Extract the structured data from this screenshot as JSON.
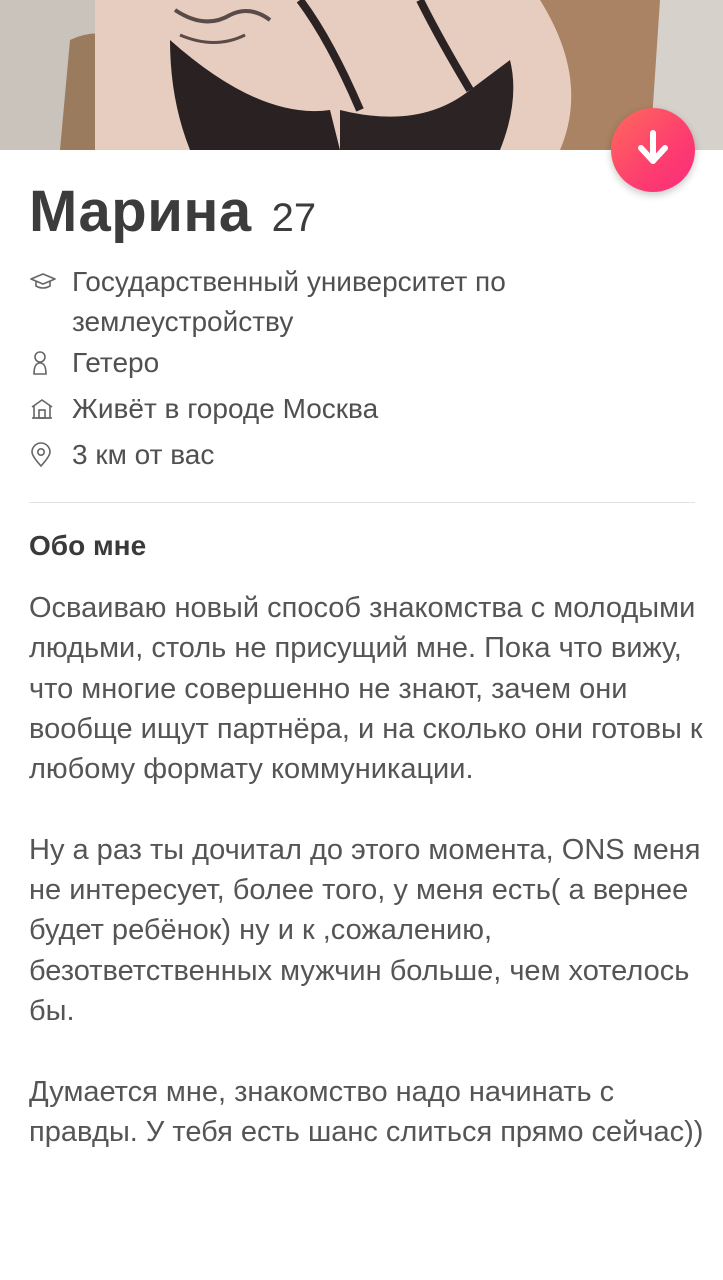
{
  "profile": {
    "name": "Марина",
    "age": "27",
    "education": "Государственный университет по землеустройству",
    "orientation": "Гетеро",
    "city": "Живёт в городе Москва",
    "distance": "3 км от вас"
  },
  "about": {
    "title": "Обо мне",
    "text": "Осваиваю новый способ знакомства с молодыми людьми, столь не присущий мне. Пока что вижу, что многие совершенно не знают, зачем они вообще ищут партнёра, и на сколько они готовы к любому формату коммуникации.\n\nНу а раз ты дочитал до этого момента, ONS меня не интересует, более того, у меня есть( а вернее будет ребёнок) ну и к ,сожалению, безответственных мужчин больше, чем хотелось бы.\n\nДумается мне, знакомство надо начинать с правды. У тебя есть шанс слиться прямо сейчас))"
  },
  "icons": {
    "collapse": "arrow-down-icon",
    "education": "graduation-cap-icon",
    "orientation": "person-icon",
    "city": "house-icon",
    "distance": "location-pin-icon"
  },
  "colors": {
    "accent_start": "#ff6a5c",
    "accent_end": "#fb2c7a",
    "text": "#424242"
  }
}
